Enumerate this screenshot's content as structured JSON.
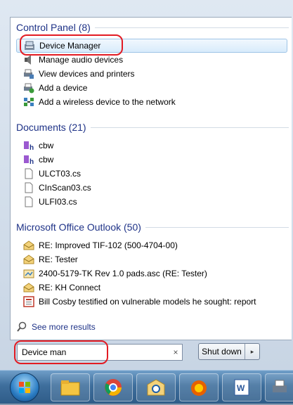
{
  "groups": {
    "control_panel": {
      "title": "Control Panel (8)",
      "items": [
        "Device Manager",
        "Manage audio devices",
        "View devices and printers",
        "Add a device",
        "Add a wireless device to the network"
      ]
    },
    "documents": {
      "title": "Documents (21)",
      "items": [
        "cbw",
        "cbw",
        "ULCT03.cs",
        "CInScan03.cs",
        "ULFI03.cs"
      ]
    },
    "outlook": {
      "title": "Microsoft Office Outlook (50)",
      "items": [
        "RE: Improved TIF-102 (500-4704-00)",
        "RE: Tester",
        "2400-5179-TK Rev 1.0 pads.asc (RE: Tester)",
        "RE: KH Connect",
        "Bill Cosby testified on vulnerable models he sought: report"
      ]
    }
  },
  "see_more": "See more results",
  "search": {
    "value": "Device man",
    "clear": "×"
  },
  "shutdown": {
    "label": "Shut down",
    "arrow": "▸"
  },
  "colors": {
    "header": "#1e3287",
    "highlight": "#e21b23",
    "selection": "#d8ebfb"
  },
  "taskbar_icons": [
    "windows-start-icon",
    "file-explorer-icon",
    "chrome-icon",
    "outlook-icon",
    "firefox-icon",
    "word-icon",
    "printer-icon"
  ]
}
